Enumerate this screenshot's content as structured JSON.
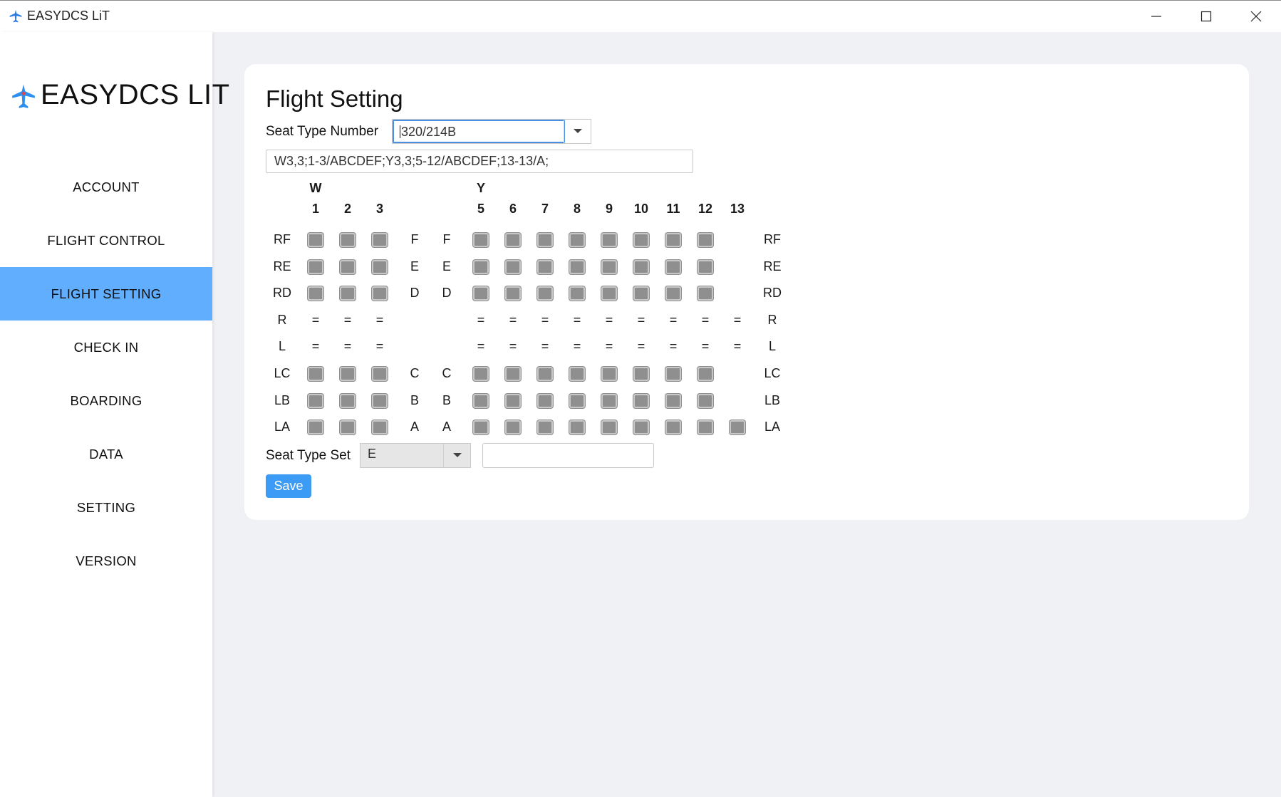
{
  "window": {
    "title": "EASYDCS LiT",
    "icon": "airplane-icon",
    "controls": [
      "minimize-icon",
      "maximize-icon",
      "close-icon"
    ]
  },
  "sidebar": {
    "brand": "EASYDCS LIT",
    "brand_icon": "airplane-icon",
    "items": [
      {
        "label": "ACCOUNT",
        "active": false
      },
      {
        "label": "FLIGHT CONTROL",
        "active": false
      },
      {
        "label": "FLIGHT SETTING",
        "active": true
      },
      {
        "label": "CHECK IN",
        "active": false
      },
      {
        "label": "BOARDING",
        "active": false
      },
      {
        "label": "DATA",
        "active": false
      },
      {
        "label": "SETTING",
        "active": false
      },
      {
        "label": "VERSION",
        "active": false
      }
    ],
    "active_color": "#61aeff"
  },
  "main": {
    "title": "Flight Setting",
    "seat_type_number": {
      "label": "Seat Type Number",
      "value": "320/214B"
    },
    "layout_string": "W3,3;1-3/ABCDEF;Y3,3;5-12/ABCDEF;13-13/A;",
    "seat_map": {
      "classes": [
        {
          "name": "W",
          "columns": [
            "1",
            "2",
            "3"
          ]
        },
        {
          "name": "Y",
          "columns": [
            "5",
            "6",
            "7",
            "8",
            "9",
            "10",
            "11",
            "12",
            "13"
          ]
        }
      ],
      "rows": [
        {
          "label": "RF",
          "letter": "F",
          "seats": [
            1,
            1,
            1,
            1,
            1,
            1,
            1,
            1,
            1,
            1,
            1,
            0
          ]
        },
        {
          "label": "RE",
          "letter": "E",
          "seats": [
            1,
            1,
            1,
            1,
            1,
            1,
            1,
            1,
            1,
            1,
            1,
            0
          ]
        },
        {
          "label": "RD",
          "letter": "D",
          "seats": [
            1,
            1,
            1,
            1,
            1,
            1,
            1,
            1,
            1,
            1,
            1,
            0
          ]
        },
        {
          "label": "R",
          "letter": "",
          "aisle": true,
          "marker": "=",
          "seats": [
            1,
            1,
            1,
            1,
            1,
            1,
            1,
            1,
            1,
            1,
            1,
            1
          ]
        },
        {
          "label": "L",
          "letter": "",
          "aisle": true,
          "marker": "=",
          "seats": [
            1,
            1,
            1,
            1,
            1,
            1,
            1,
            1,
            1,
            1,
            1,
            1
          ]
        },
        {
          "label": "LC",
          "letter": "C",
          "seats": [
            1,
            1,
            1,
            1,
            1,
            1,
            1,
            1,
            1,
            1,
            1,
            0
          ]
        },
        {
          "label": "LB",
          "letter": "B",
          "seats": [
            1,
            1,
            1,
            1,
            1,
            1,
            1,
            1,
            1,
            1,
            1,
            0
          ]
        },
        {
          "label": "LA",
          "letter": "A",
          "seats": [
            1,
            1,
            1,
            1,
            1,
            1,
            1,
            1,
            1,
            1,
            1,
            1
          ]
        }
      ],
      "seat_color": "#8f8f8f"
    },
    "seat_type_set": {
      "label": "Seat Type Set",
      "value": "E",
      "text_value": ""
    },
    "save_label": "Save",
    "accent_color": "#3b9bf5"
  }
}
